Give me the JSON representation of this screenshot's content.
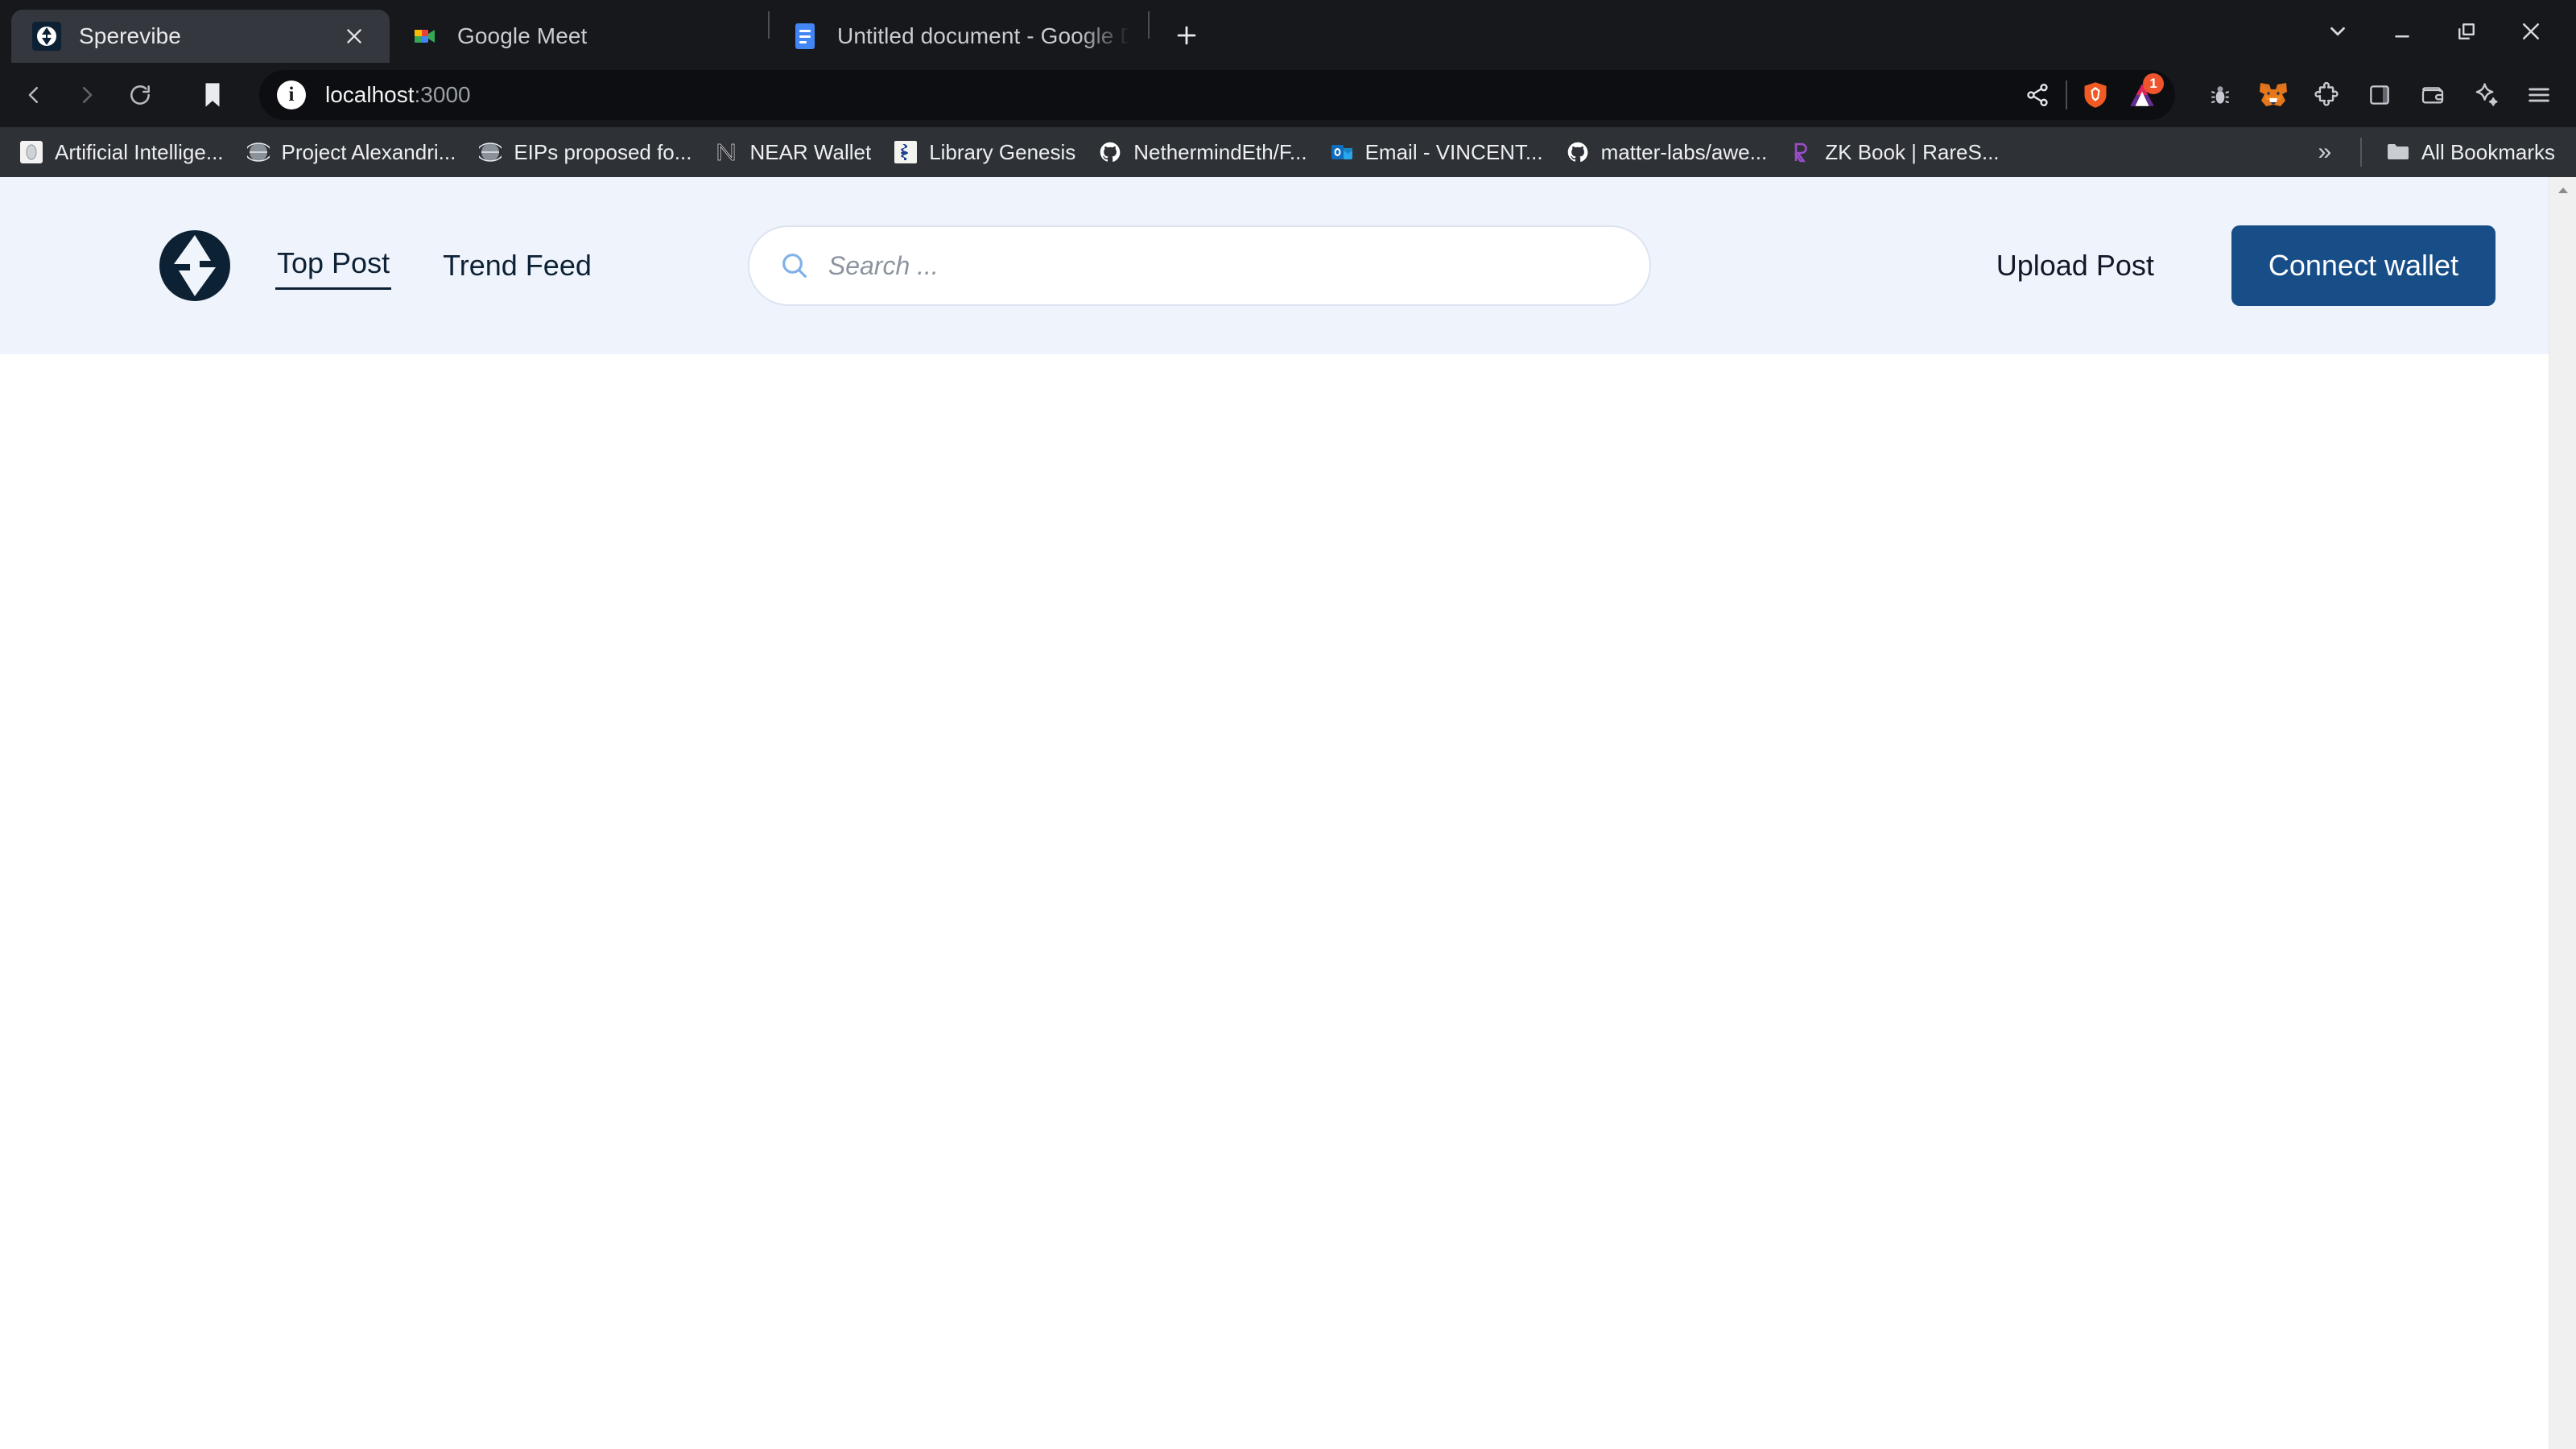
{
  "browser": {
    "tabs": [
      {
        "title": "Sperevibe",
        "favicon": "sperevibe-logo-icon",
        "active": true,
        "has_close": true
      },
      {
        "title": "Google Meet",
        "favicon": "google-meet-icon",
        "active": false,
        "has_close": false
      },
      {
        "title": "Untitled document - Google Doc",
        "favicon": "google-docs-icon",
        "active": false,
        "has_close": false
      }
    ],
    "new_tab_label": "+",
    "window_controls": [
      {
        "name": "tab-search-button",
        "glyph": "chevron-down-icon"
      },
      {
        "name": "minimize-button",
        "glyph": "minimize-icon"
      },
      {
        "name": "maximize-button",
        "glyph": "restore-icon"
      },
      {
        "name": "close-window-button",
        "glyph": "close-icon"
      }
    ],
    "toolbar": {
      "back_label": "Back",
      "forward_label": "Forward",
      "reload_label": "Reload",
      "bookmark_label": "Bookmark this page",
      "url_host": "localhost",
      "url_port": ":3000",
      "site_info_label": "i",
      "omnibox_actions": [
        {
          "name": "share-icon",
          "badge": null
        },
        {
          "name": "brave-shields-icon",
          "badge": null
        },
        {
          "name": "brave-rewards-icon",
          "badge": "1"
        }
      ],
      "extensions": [
        {
          "name": "bug-icon"
        },
        {
          "name": "metamask-fox-icon"
        },
        {
          "name": "extensions-puzzle-icon"
        },
        {
          "name": "sidebar-panel-icon"
        },
        {
          "name": "wallet-icon"
        },
        {
          "name": "leo-ai-sparkle-icon"
        },
        {
          "name": "browser-menu-icon"
        }
      ]
    },
    "bookmarks": {
      "items": [
        {
          "label": "Artificial Intellige...",
          "icon": "generic-page-icon"
        },
        {
          "label": "Project Alexandri...",
          "icon": "globe-icon"
        },
        {
          "label": "EIPs proposed fo...",
          "icon": "globe-icon"
        },
        {
          "label": "NEAR Wallet",
          "icon": "near-icon"
        },
        {
          "label": "Library Genesis",
          "icon": "libgen-icon"
        },
        {
          "label": "NethermindEth/F...",
          "icon": "github-icon"
        },
        {
          "label": "Email - VINCENT...",
          "icon": "outlook-icon"
        },
        {
          "label": "matter-labs/awe...",
          "icon": "github-icon"
        },
        {
          "label": "ZK Book | RareS...",
          "icon": "rareskills-icon"
        }
      ],
      "overflow_label": "»",
      "all_bookmarks_label": "All Bookmarks",
      "all_bookmarks_icon": "folder-icon"
    }
  },
  "app": {
    "logo_name": "sperevibe-logo",
    "nav": [
      {
        "label": "Top Post",
        "active": true
      },
      {
        "label": "Trend Feed",
        "active": false
      }
    ],
    "search": {
      "placeholder": "Search ...",
      "value": "",
      "icon": "search-icon"
    },
    "upload_label": "Upload Post",
    "connect_label": "Connect wallet",
    "colors": {
      "navbar_bg": "#eff4fc",
      "brand_navy": "#0d2135",
      "connect_button": "#174e88",
      "search_icon": "#7fb1e8",
      "page_bg": "#ffffff"
    }
  },
  "scrollbar": {
    "up_arrow_label": "Scroll up",
    "track_label": "Vertical scrollbar"
  }
}
